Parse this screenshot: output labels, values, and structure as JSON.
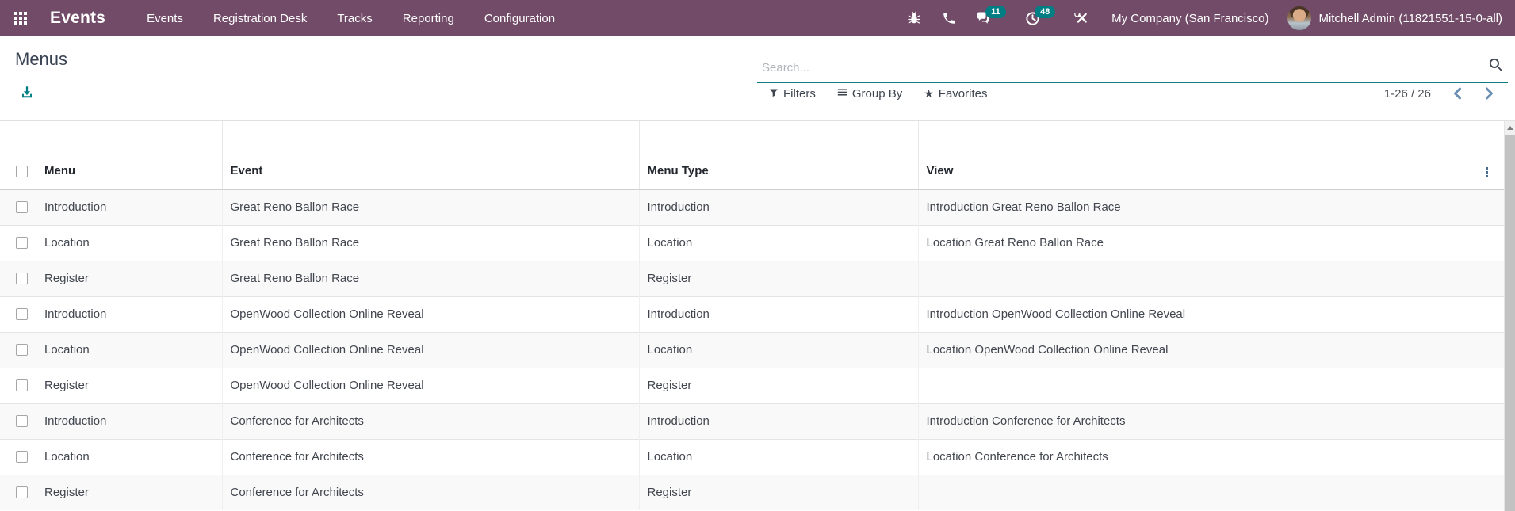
{
  "navbar": {
    "app_name": "Events",
    "menu_items": [
      "Events",
      "Registration Desk",
      "Tracks",
      "Reporting",
      "Configuration"
    ],
    "systray": {
      "icons": [
        "bug-icon",
        "phone-icon",
        "messages-icon",
        "activities-icon",
        "tools-icon"
      ],
      "messages_badge": "11",
      "activities_badge": "48",
      "company": "My Company (San Francisco)",
      "user": "Mitchell Admin (11821551-15-0-all)"
    }
  },
  "control_panel": {
    "breadcrumb": "Menus",
    "search_placeholder": "Search...",
    "export_icon": "download-icon",
    "buttons": {
      "filters": "Filters",
      "group_by": "Group By",
      "favorites": "Favorites"
    },
    "pager_range": "1-26 / 26"
  },
  "table": {
    "columns": [
      "Menu",
      "Event",
      "Menu Type",
      "View"
    ],
    "rows": [
      {
        "menu": "Introduction",
        "event": "Great Reno Ballon Race",
        "menu_type": "Introduction",
        "view": "Introduction Great Reno Ballon Race"
      },
      {
        "menu": "Location",
        "event": "Great Reno Ballon Race",
        "menu_type": "Location",
        "view": "Location Great Reno Ballon Race"
      },
      {
        "menu": "Register",
        "event": "Great Reno Ballon Race",
        "menu_type": "Register",
        "view": ""
      },
      {
        "menu": "Introduction",
        "event": "OpenWood Collection Online Reveal",
        "menu_type": "Introduction",
        "view": "Introduction OpenWood Collection Online Reveal"
      },
      {
        "menu": "Location",
        "event": "OpenWood Collection Online Reveal",
        "menu_type": "Location",
        "view": "Location OpenWood Collection Online Reveal"
      },
      {
        "menu": "Register",
        "event": "OpenWood Collection Online Reveal",
        "menu_type": "Register",
        "view": ""
      },
      {
        "menu": "Introduction",
        "event": "Conference for Architects",
        "menu_type": "Introduction",
        "view": "Introduction Conference for Architects"
      },
      {
        "menu": "Location",
        "event": "Conference for Architects",
        "menu_type": "Location",
        "view": "Location Conference for Architects"
      },
      {
        "menu": "Register",
        "event": "Conference for Architects",
        "menu_type": "Register",
        "view": ""
      }
    ]
  },
  "colors": {
    "navbar_bg": "#714B67",
    "badge_bg": "#017e84",
    "accent_teal": "#017e84",
    "search_underline": "#0e7d80",
    "pager_chevron": "#6b8fb3",
    "kebab_dots": "#466b96"
  }
}
